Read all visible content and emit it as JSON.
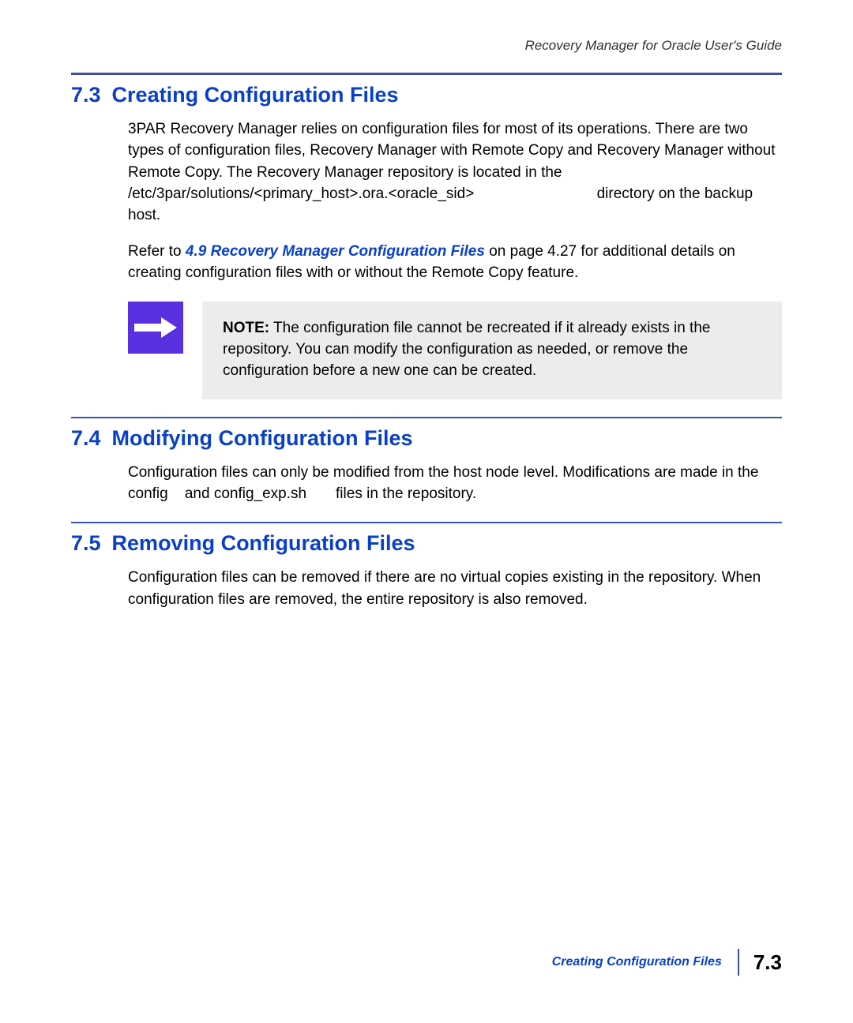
{
  "running_title": "Recovery Manager for Oracle User's Guide",
  "sections": {
    "s73": {
      "number": "7.3",
      "title": "Creating Configuration Files",
      "p1a": "3PAR Recovery Manager relies on configuration files for most of its operations. There are two types of configuration files, Recovery Manager with Remote Copy and Recovery Manager without Remote Copy. The Recovery Manager repository is located in the ",
      "path": "/etc/3par/solutions/<primary_host>.ora.<oracle_sid>",
      "p1b": "directory on the backup host.",
      "p2a": "Refer to ",
      "link": "4.9 Recovery Manager Configuration Files",
      "p2b": " on page 4.27 for additional details on creating configuration files with or without the Remote Copy feature.",
      "note_label": "NOTE:",
      "note_body": " The configuration file cannot be recreated if it already exists in the repository. You can modify the configuration as needed, or remove the configuration before a new one can be created."
    },
    "s74": {
      "number": "7.4",
      "title": "Modifying Configuration Files",
      "p1a": "Configuration files can only be modified from the host node level. Modifications are made in the ",
      "code1": "config",
      "p1b": " and ",
      "code2": "config_exp.sh",
      "p1c": " files in the repository."
    },
    "s75": {
      "number": "7.5",
      "title": "Removing Configuration Files",
      "p1": "Configuration files can be removed if there are no virtual copies existing in the repository. When configuration files are removed, the entire repository is also removed."
    }
  },
  "footer": {
    "title": "Creating Configuration Files",
    "page": "7.3"
  }
}
